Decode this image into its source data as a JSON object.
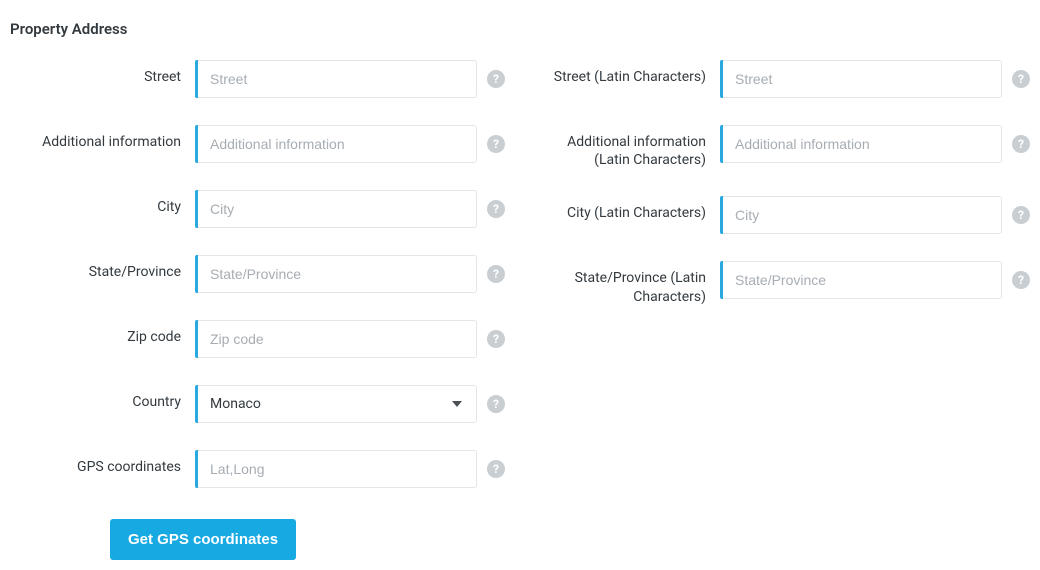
{
  "section_title": "Property Address",
  "left": {
    "street": {
      "label": "Street",
      "placeholder": "Street",
      "value": ""
    },
    "addl": {
      "label": "Additional information",
      "placeholder": "Additional information",
      "value": ""
    },
    "city": {
      "label": "City",
      "placeholder": "City",
      "value": ""
    },
    "state": {
      "label": "State/Province",
      "placeholder": "State/Province",
      "value": ""
    },
    "zip": {
      "label": "Zip code",
      "placeholder": "Zip code",
      "value": ""
    },
    "country": {
      "label": "Country",
      "selected": "Monaco"
    },
    "gps": {
      "label": "GPS coordinates",
      "placeholder": "Lat,Long",
      "value": ""
    }
  },
  "right": {
    "street": {
      "label": "Street (Latin Characters)",
      "placeholder": "Street",
      "value": ""
    },
    "addl": {
      "label": "Additional information (Latin Characters)",
      "placeholder": "Additional information",
      "value": ""
    },
    "city": {
      "label": "City (Latin Characters)",
      "placeholder": "City",
      "value": ""
    },
    "state": {
      "label": "State/Province (Latin Characters)",
      "placeholder": "State/Province",
      "value": ""
    }
  },
  "button_gps": "Get GPS coordinates",
  "help_glyph": "?"
}
